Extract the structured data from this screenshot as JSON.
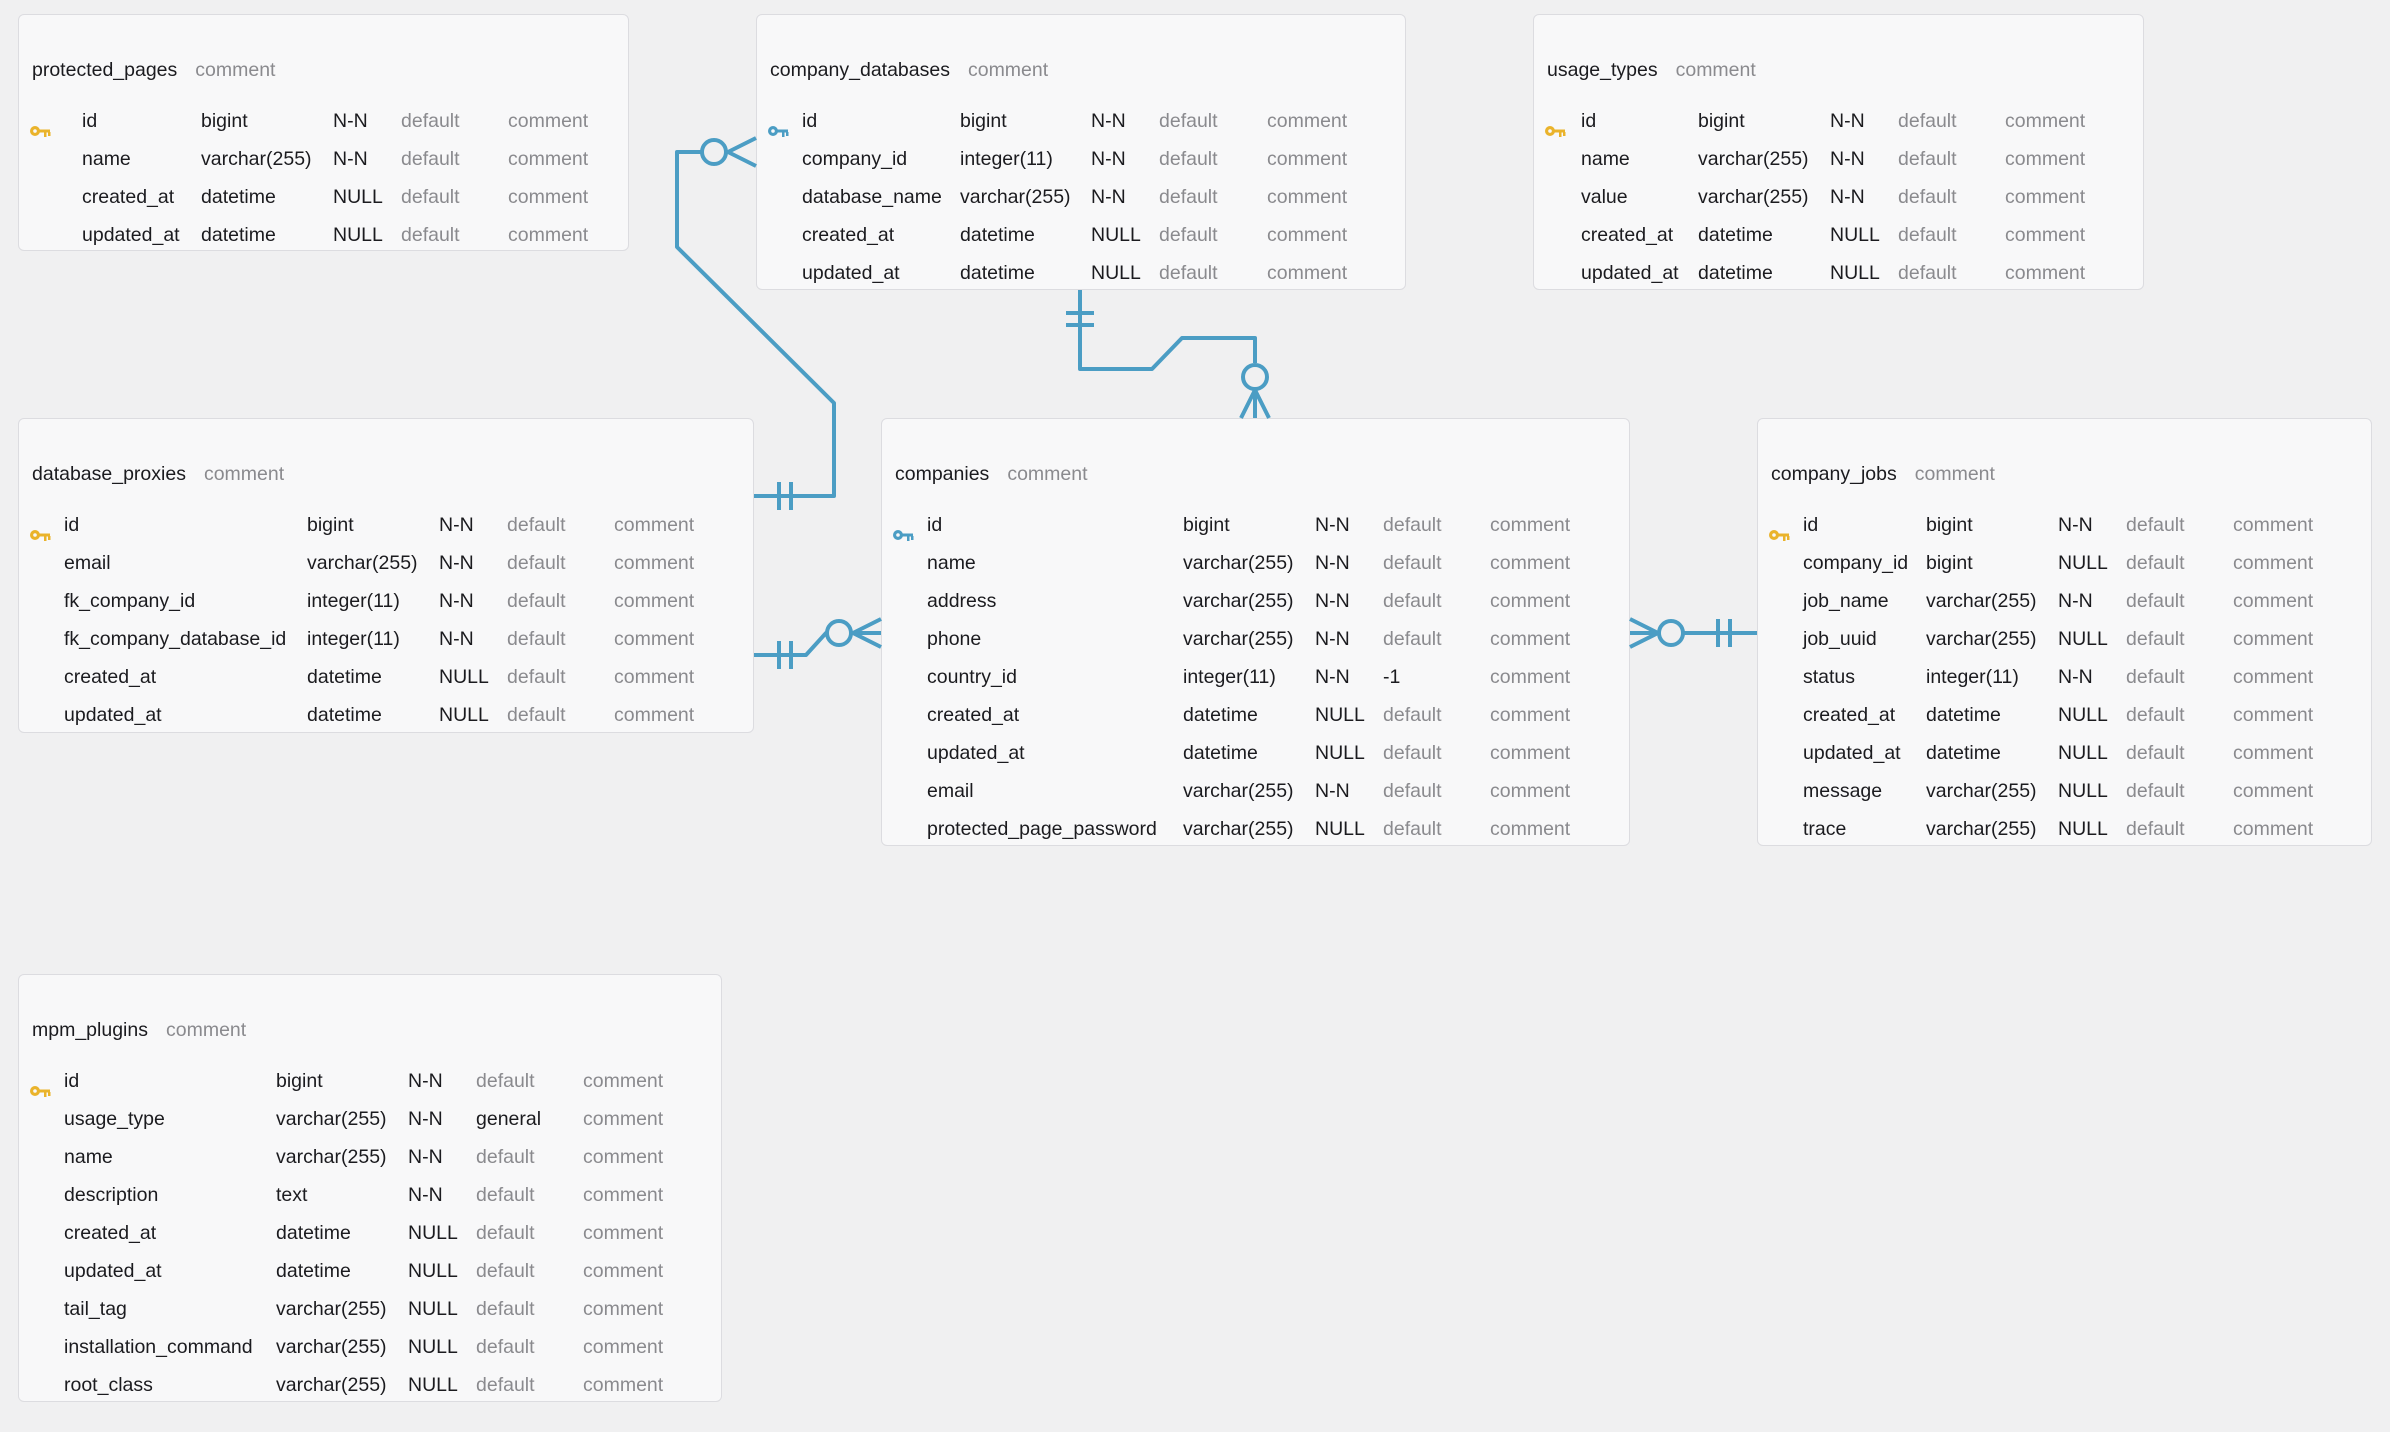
{
  "colors": {
    "link": "#4b9dc4",
    "pk_key_gold": "#eab32b",
    "pk_key_blue": "#4b9dc4"
  },
  "tables": [
    {
      "id": "protected_pages",
      "title": "protected_pages",
      "comment": "comment",
      "pk_icon": "key-icon-gold",
      "columns": [
        {
          "name": "id",
          "type": "bigint",
          "nullable": "N-N",
          "default": "default",
          "comment": "comment",
          "pk": true
        },
        {
          "name": "name",
          "type": "varchar(255)",
          "nullable": "N-N",
          "default": "default",
          "comment": "comment"
        },
        {
          "name": "created_at",
          "type": "datetime",
          "nullable": "NULL",
          "default": "default",
          "comment": "comment"
        },
        {
          "name": "updated_at",
          "type": "datetime",
          "nullable": "NULL",
          "default": "default",
          "comment": "comment"
        }
      ]
    },
    {
      "id": "company_databases",
      "title": "company_databases",
      "comment": "comment",
      "pk_icon": "key-icon-blue",
      "columns": [
        {
          "name": "id",
          "type": "bigint",
          "nullable": "N-N",
          "default": "default",
          "comment": "comment",
          "pk": true
        },
        {
          "name": "company_id",
          "type": "integer(11)",
          "nullable": "N-N",
          "default": "default",
          "comment": "comment"
        },
        {
          "name": "database_name",
          "type": "varchar(255)",
          "nullable": "N-N",
          "default": "default",
          "comment": "comment"
        },
        {
          "name": "created_at",
          "type": "datetime",
          "nullable": "NULL",
          "default": "default",
          "comment": "comment"
        },
        {
          "name": "updated_at",
          "type": "datetime",
          "nullable": "NULL",
          "default": "default",
          "comment": "comment"
        }
      ]
    },
    {
      "id": "usage_types",
      "title": "usage_types",
      "comment": "comment",
      "pk_icon": "key-icon-gold",
      "columns": [
        {
          "name": "id",
          "type": "bigint",
          "nullable": "N-N",
          "default": "default",
          "comment": "comment",
          "pk": true
        },
        {
          "name": "name",
          "type": "varchar(255)",
          "nullable": "N-N",
          "default": "default",
          "comment": "comment"
        },
        {
          "name": "value",
          "type": "varchar(255)",
          "nullable": "N-N",
          "default": "default",
          "comment": "comment"
        },
        {
          "name": "created_at",
          "type": "datetime",
          "nullable": "NULL",
          "default": "default",
          "comment": "comment"
        },
        {
          "name": "updated_at",
          "type": "datetime",
          "nullable": "NULL",
          "default": "default",
          "comment": "comment"
        }
      ]
    },
    {
      "id": "database_proxies",
      "title": "database_proxies",
      "comment": "comment",
      "pk_icon": "key-icon-gold",
      "columns": [
        {
          "name": "id",
          "type": "bigint",
          "nullable": "N-N",
          "default": "default",
          "comment": "comment",
          "pk": true
        },
        {
          "name": "email",
          "type": "varchar(255)",
          "nullable": "N-N",
          "default": "default",
          "comment": "comment"
        },
        {
          "name": "fk_company_id",
          "type": "integer(11)",
          "nullable": "N-N",
          "default": "default",
          "comment": "comment"
        },
        {
          "name": "fk_company_database_id",
          "type": "integer(11)",
          "nullable": "N-N",
          "default": "default",
          "comment": "comment"
        },
        {
          "name": "created_at",
          "type": "datetime",
          "nullable": "NULL",
          "default": "default",
          "comment": "comment"
        },
        {
          "name": "updated_at",
          "type": "datetime",
          "nullable": "NULL",
          "default": "default",
          "comment": "comment"
        }
      ]
    },
    {
      "id": "companies",
      "title": "companies",
      "comment": "comment",
      "pk_icon": "key-icon-blue",
      "columns": [
        {
          "name": "id",
          "type": "bigint",
          "nullable": "N-N",
          "default": "default",
          "comment": "comment",
          "pk": true
        },
        {
          "name": "name",
          "type": "varchar(255)",
          "nullable": "N-N",
          "default": "default",
          "comment": "comment"
        },
        {
          "name": "address",
          "type": "varchar(255)",
          "nullable": "N-N",
          "default": "default",
          "comment": "comment"
        },
        {
          "name": "phone",
          "type": "varchar(255)",
          "nullable": "N-N",
          "default": "default",
          "comment": "comment"
        },
        {
          "name": "country_id",
          "type": "integer(11)",
          "nullable": "N-N",
          "default": "-1",
          "comment": "comment"
        },
        {
          "name": "created_at",
          "type": "datetime",
          "nullable": "NULL",
          "default": "default",
          "comment": "comment"
        },
        {
          "name": "updated_at",
          "type": "datetime",
          "nullable": "NULL",
          "default": "default",
          "comment": "comment"
        },
        {
          "name": "email",
          "type": "varchar(255)",
          "nullable": "N-N",
          "default": "default",
          "comment": "comment"
        },
        {
          "name": "protected_page_password",
          "type": "varchar(255)",
          "nullable": "NULL",
          "default": "default",
          "comment": "comment"
        }
      ]
    },
    {
      "id": "company_jobs",
      "title": "company_jobs",
      "comment": "comment",
      "pk_icon": "key-icon-gold",
      "columns": [
        {
          "name": "id",
          "type": "bigint",
          "nullable": "N-N",
          "default": "default",
          "comment": "comment",
          "pk": true
        },
        {
          "name": "company_id",
          "type": "bigint",
          "nullable": "NULL",
          "default": "default",
          "comment": "comment"
        },
        {
          "name": "job_name",
          "type": "varchar(255)",
          "nullable": "N-N",
          "default": "default",
          "comment": "comment"
        },
        {
          "name": "job_uuid",
          "type": "varchar(255)",
          "nullable": "NULL",
          "default": "default",
          "comment": "comment"
        },
        {
          "name": "status",
          "type": "integer(11)",
          "nullable": "N-N",
          "default": "default",
          "comment": "comment"
        },
        {
          "name": "created_at",
          "type": "datetime",
          "nullable": "NULL",
          "default": "default",
          "comment": "comment"
        },
        {
          "name": "updated_at",
          "type": "datetime",
          "nullable": "NULL",
          "default": "default",
          "comment": "comment"
        },
        {
          "name": "message",
          "type": "varchar(255)",
          "nullable": "NULL",
          "default": "default",
          "comment": "comment"
        },
        {
          "name": "trace",
          "type": "varchar(255)",
          "nullable": "NULL",
          "default": "default",
          "comment": "comment"
        }
      ]
    },
    {
      "id": "mpm_plugins",
      "title": "mpm_plugins",
      "comment": "comment",
      "pk_icon": "key-icon-gold",
      "columns": [
        {
          "name": "id",
          "type": "bigint",
          "nullable": "N-N",
          "default": "default",
          "comment": "comment",
          "pk": true
        },
        {
          "name": "usage_type",
          "type": "varchar(255)",
          "nullable": "N-N",
          "default": "general",
          "comment": "comment"
        },
        {
          "name": "name",
          "type": "varchar(255)",
          "nullable": "N-N",
          "default": "default",
          "comment": "comment"
        },
        {
          "name": "description",
          "type": "text",
          "nullable": "N-N",
          "default": "default",
          "comment": "comment"
        },
        {
          "name": "created_at",
          "type": "datetime",
          "nullable": "NULL",
          "default": "default",
          "comment": "comment"
        },
        {
          "name": "updated_at",
          "type": "datetime",
          "nullable": "NULL",
          "default": "default",
          "comment": "comment"
        },
        {
          "name": "tail_tag",
          "type": "varchar(255)",
          "nullable": "NULL",
          "default": "default",
          "comment": "comment"
        },
        {
          "name": "installation_command",
          "type": "varchar(255)",
          "nullable": "NULL",
          "default": "default",
          "comment": "comment"
        },
        {
          "name": "root_class",
          "type": "varchar(255)",
          "nullable": "NULL",
          "default": "default",
          "comment": "comment"
        }
      ]
    }
  ],
  "relations": [
    {
      "from": "database_proxies",
      "to": "protected_pages",
      "from_cardinality": "exactly-one",
      "to_cardinality": "zero-or-many"
    },
    {
      "from": "company_databases",
      "to": "companies",
      "from_cardinality": "exactly-one",
      "to_cardinality": "zero-or-many"
    },
    {
      "from": "database_proxies",
      "to": "companies",
      "from_cardinality": "exactly-one",
      "to_cardinality": "zero-or-many"
    },
    {
      "from": "company_jobs",
      "to": "companies",
      "from_cardinality": "exactly-one",
      "to_cardinality": "zero-or-many"
    }
  ]
}
